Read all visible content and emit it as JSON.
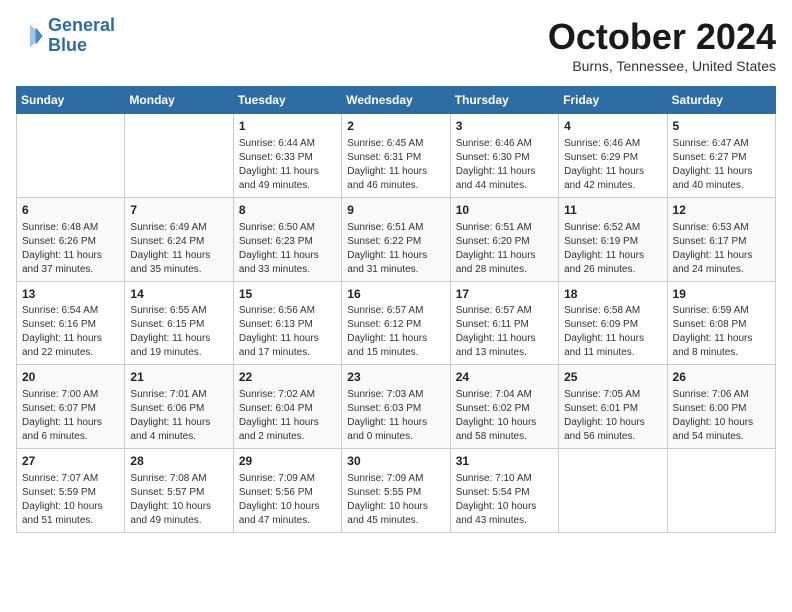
{
  "logo": {
    "line1": "General",
    "line2": "Blue"
  },
  "title": "October 2024",
  "location": "Burns, Tennessee, United States",
  "weekdays": [
    "Sunday",
    "Monday",
    "Tuesday",
    "Wednesday",
    "Thursday",
    "Friday",
    "Saturday"
  ],
  "weeks": [
    [
      {
        "day": "",
        "sunrise": "",
        "sunset": "",
        "daylight": ""
      },
      {
        "day": "",
        "sunrise": "",
        "sunset": "",
        "daylight": ""
      },
      {
        "day": "1",
        "sunrise": "Sunrise: 6:44 AM",
        "sunset": "Sunset: 6:33 PM",
        "daylight": "Daylight: 11 hours and 49 minutes."
      },
      {
        "day": "2",
        "sunrise": "Sunrise: 6:45 AM",
        "sunset": "Sunset: 6:31 PM",
        "daylight": "Daylight: 11 hours and 46 minutes."
      },
      {
        "day": "3",
        "sunrise": "Sunrise: 6:46 AM",
        "sunset": "Sunset: 6:30 PM",
        "daylight": "Daylight: 11 hours and 44 minutes."
      },
      {
        "day": "4",
        "sunrise": "Sunrise: 6:46 AM",
        "sunset": "Sunset: 6:29 PM",
        "daylight": "Daylight: 11 hours and 42 minutes."
      },
      {
        "day": "5",
        "sunrise": "Sunrise: 6:47 AM",
        "sunset": "Sunset: 6:27 PM",
        "daylight": "Daylight: 11 hours and 40 minutes."
      }
    ],
    [
      {
        "day": "6",
        "sunrise": "Sunrise: 6:48 AM",
        "sunset": "Sunset: 6:26 PM",
        "daylight": "Daylight: 11 hours and 37 minutes."
      },
      {
        "day": "7",
        "sunrise": "Sunrise: 6:49 AM",
        "sunset": "Sunset: 6:24 PM",
        "daylight": "Daylight: 11 hours and 35 minutes."
      },
      {
        "day": "8",
        "sunrise": "Sunrise: 6:50 AM",
        "sunset": "Sunset: 6:23 PM",
        "daylight": "Daylight: 11 hours and 33 minutes."
      },
      {
        "day": "9",
        "sunrise": "Sunrise: 6:51 AM",
        "sunset": "Sunset: 6:22 PM",
        "daylight": "Daylight: 11 hours and 31 minutes."
      },
      {
        "day": "10",
        "sunrise": "Sunrise: 6:51 AM",
        "sunset": "Sunset: 6:20 PM",
        "daylight": "Daylight: 11 hours and 28 minutes."
      },
      {
        "day": "11",
        "sunrise": "Sunrise: 6:52 AM",
        "sunset": "Sunset: 6:19 PM",
        "daylight": "Daylight: 11 hours and 26 minutes."
      },
      {
        "day": "12",
        "sunrise": "Sunrise: 6:53 AM",
        "sunset": "Sunset: 6:17 PM",
        "daylight": "Daylight: 11 hours and 24 minutes."
      }
    ],
    [
      {
        "day": "13",
        "sunrise": "Sunrise: 6:54 AM",
        "sunset": "Sunset: 6:16 PM",
        "daylight": "Daylight: 11 hours and 22 minutes."
      },
      {
        "day": "14",
        "sunrise": "Sunrise: 6:55 AM",
        "sunset": "Sunset: 6:15 PM",
        "daylight": "Daylight: 11 hours and 19 minutes."
      },
      {
        "day": "15",
        "sunrise": "Sunrise: 6:56 AM",
        "sunset": "Sunset: 6:13 PM",
        "daylight": "Daylight: 11 hours and 17 minutes."
      },
      {
        "day": "16",
        "sunrise": "Sunrise: 6:57 AM",
        "sunset": "Sunset: 6:12 PM",
        "daylight": "Daylight: 11 hours and 15 minutes."
      },
      {
        "day": "17",
        "sunrise": "Sunrise: 6:57 AM",
        "sunset": "Sunset: 6:11 PM",
        "daylight": "Daylight: 11 hours and 13 minutes."
      },
      {
        "day": "18",
        "sunrise": "Sunrise: 6:58 AM",
        "sunset": "Sunset: 6:09 PM",
        "daylight": "Daylight: 11 hours and 11 minutes."
      },
      {
        "day": "19",
        "sunrise": "Sunrise: 6:59 AM",
        "sunset": "Sunset: 6:08 PM",
        "daylight": "Daylight: 11 hours and 8 minutes."
      }
    ],
    [
      {
        "day": "20",
        "sunrise": "Sunrise: 7:00 AM",
        "sunset": "Sunset: 6:07 PM",
        "daylight": "Daylight: 11 hours and 6 minutes."
      },
      {
        "day": "21",
        "sunrise": "Sunrise: 7:01 AM",
        "sunset": "Sunset: 6:06 PM",
        "daylight": "Daylight: 11 hours and 4 minutes."
      },
      {
        "day": "22",
        "sunrise": "Sunrise: 7:02 AM",
        "sunset": "Sunset: 6:04 PM",
        "daylight": "Daylight: 11 hours and 2 minutes."
      },
      {
        "day": "23",
        "sunrise": "Sunrise: 7:03 AM",
        "sunset": "Sunset: 6:03 PM",
        "daylight": "Daylight: 11 hours and 0 minutes."
      },
      {
        "day": "24",
        "sunrise": "Sunrise: 7:04 AM",
        "sunset": "Sunset: 6:02 PM",
        "daylight": "Daylight: 10 hours and 58 minutes."
      },
      {
        "day": "25",
        "sunrise": "Sunrise: 7:05 AM",
        "sunset": "Sunset: 6:01 PM",
        "daylight": "Daylight: 10 hours and 56 minutes."
      },
      {
        "day": "26",
        "sunrise": "Sunrise: 7:06 AM",
        "sunset": "Sunset: 6:00 PM",
        "daylight": "Daylight: 10 hours and 54 minutes."
      }
    ],
    [
      {
        "day": "27",
        "sunrise": "Sunrise: 7:07 AM",
        "sunset": "Sunset: 5:59 PM",
        "daylight": "Daylight: 10 hours and 51 minutes."
      },
      {
        "day": "28",
        "sunrise": "Sunrise: 7:08 AM",
        "sunset": "Sunset: 5:57 PM",
        "daylight": "Daylight: 10 hours and 49 minutes."
      },
      {
        "day": "29",
        "sunrise": "Sunrise: 7:09 AM",
        "sunset": "Sunset: 5:56 PM",
        "daylight": "Daylight: 10 hours and 47 minutes."
      },
      {
        "day": "30",
        "sunrise": "Sunrise: 7:09 AM",
        "sunset": "Sunset: 5:55 PM",
        "daylight": "Daylight: 10 hours and 45 minutes."
      },
      {
        "day": "31",
        "sunrise": "Sunrise: 7:10 AM",
        "sunset": "Sunset: 5:54 PM",
        "daylight": "Daylight: 10 hours and 43 minutes."
      },
      {
        "day": "",
        "sunrise": "",
        "sunset": "",
        "daylight": ""
      },
      {
        "day": "",
        "sunrise": "",
        "sunset": "",
        "daylight": ""
      }
    ]
  ]
}
